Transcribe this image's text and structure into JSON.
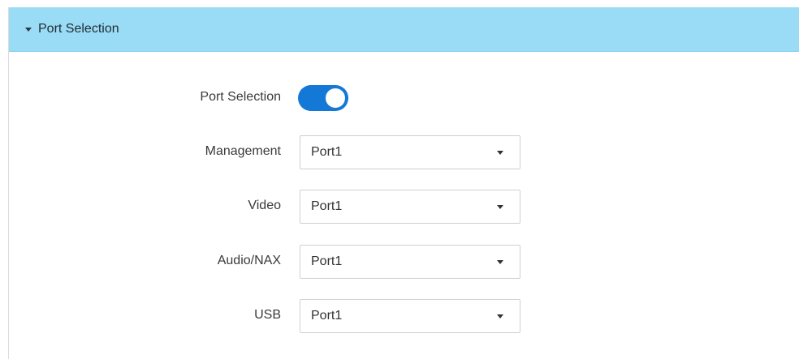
{
  "section": {
    "title": "Port Selection",
    "header_color": "#9adcf5"
  },
  "port_selection": {
    "label": "Port Selection",
    "enabled": true,
    "toggle_color": "#1479d6"
  },
  "fields": {
    "management": {
      "label": "Management",
      "value": "Port1"
    },
    "video": {
      "label": "Video",
      "value": "Port1"
    },
    "audio_nax": {
      "label": "Audio/NAX",
      "value": "Port1"
    },
    "usb": {
      "label": "USB",
      "value": "Port1"
    }
  },
  "icons": {
    "section_caret": "caret-down-icon",
    "select_arrow": "dropdown-arrow-icon"
  }
}
